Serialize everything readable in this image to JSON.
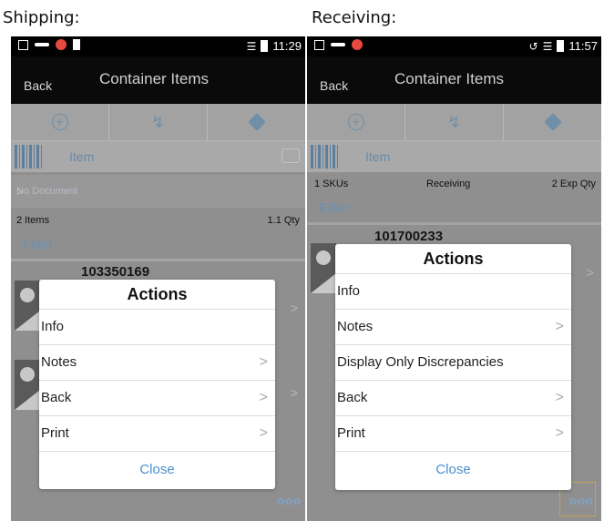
{
  "captions": {
    "shipping": "Shipping:",
    "receiving": "Receiving:"
  },
  "shipping": {
    "time": "11:29",
    "back_label": "Back",
    "title": "Container Items",
    "item_label": "Item",
    "document_label": "No Document",
    "summary_left": "2 Items",
    "summary_right": "1.1 Qty",
    "filter_label": "Filter",
    "sku": "103350169",
    "more_label": "ooo",
    "dialog": {
      "title": "Actions",
      "items": [
        {
          "label": "Info",
          "arrow": ""
        },
        {
          "label": "Notes",
          "arrow": ">"
        },
        {
          "label": "Back",
          "arrow": ">"
        },
        {
          "label": "Print",
          "arrow": ">"
        }
      ],
      "close_label": "Close"
    }
  },
  "receiving": {
    "time": "11:57",
    "back_label": "Back",
    "title": "Container Items",
    "item_label": "Item",
    "summary_left": "1 SKUs",
    "summary_mid": "Receiving",
    "summary_right": "2 Exp Qty",
    "filter_label": "Filter",
    "sku": "101700233",
    "more_label": "ooo",
    "dialog": {
      "title": "Actions",
      "items": [
        {
          "label": "Info",
          "arrow": ""
        },
        {
          "label": "Notes",
          "arrow": ">"
        },
        {
          "label": "Display Only Discrepancies",
          "arrow": ""
        },
        {
          "label": "Back",
          "arrow": ">"
        },
        {
          "label": "Print",
          "arrow": ">"
        }
      ],
      "close_label": "Close"
    }
  },
  "icons": {
    "add": "plus-circle-icon",
    "quick": "lightning-icon",
    "container": "cube-icon",
    "barcode": "barcode-icon",
    "camera": "camera-icon",
    "chevron": "chevron-right-icon"
  },
  "colors": {
    "accent": "#4a8fd0",
    "title_bar": "#0a0a0a",
    "overlay": "#8f8f8f",
    "link": "#6d8fb0"
  }
}
